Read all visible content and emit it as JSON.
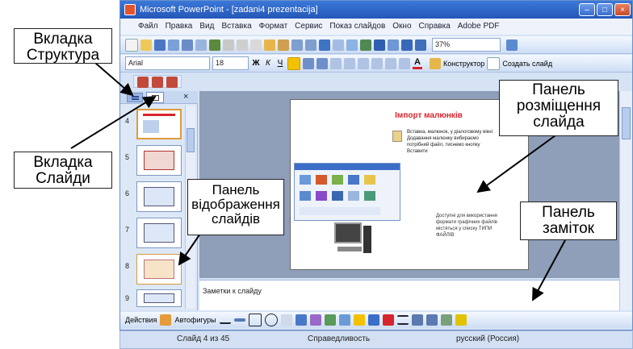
{
  "window": {
    "title": "Microsoft PowerPoint - [zadani4 prezentacija]",
    "controls": [
      "–",
      "□",
      "×"
    ]
  },
  "menu": {
    "items": [
      "Файл",
      "Правка",
      "Вид",
      "Вставка",
      "Формат",
      "Сервис",
      "Показ слайдов",
      "Окно",
      "Справка",
      "Adobe PDF"
    ]
  },
  "toolbar": {
    "zoom": "37%",
    "font_name": "Arial",
    "font_size": "18",
    "bold": "Ж",
    "italic": "К",
    "underline": "Ч",
    "designer_label": "Конструктор",
    "new_slide_label": "Создать слайд",
    "font_color_icon": "A"
  },
  "left_pane": {
    "tab_close": "×",
    "slide_numbers": [
      "4",
      "5",
      "6",
      "7",
      "8",
      "9"
    ]
  },
  "slide": {
    "title": "Імпорт малюнків",
    "body": "Вставка, малюнок, у діалоговому вікні Додавання малюнку вибираємо потрібний файл, тиснемо кнопку Вставити",
    "footnote": "Доступні для використання формати графічних файлів містяться у списку ТИПИ ФАЙЛІВ"
  },
  "notes": {
    "placeholder": "Заметки к слайду"
  },
  "drawing": {
    "actions_label": "Действия",
    "autoshapes_label": "Автофигуры"
  },
  "status": {
    "slide_of": "Слайд 4 из 45",
    "design": "Справедливость",
    "language": "русский (Россия)"
  },
  "callouts": {
    "structure_tab": "Вкладка\nСтруктура",
    "slides_tab": "Вкладка\nСлайди",
    "slides_panel": "Панель\nвідображення\nслайдів",
    "slide_panel": "Панель\nрозміщення\nслайда",
    "notes_panel": "Панель\nзаміток"
  },
  "colors": {
    "title_bar": "#2457b8",
    "slide_title": "#d8242c",
    "selected_thumb": "#e09a3a"
  }
}
